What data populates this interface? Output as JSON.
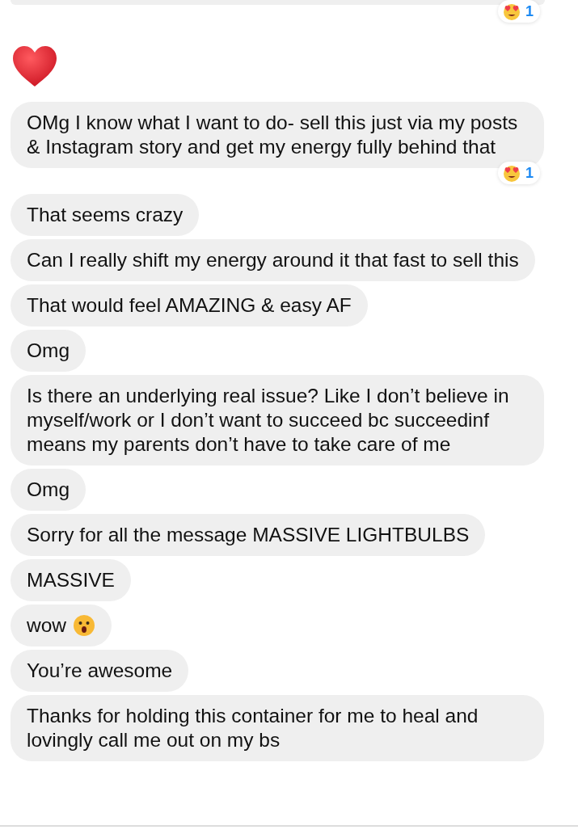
{
  "messages": [
    {
      "kind": "clipped",
      "reaction": {
        "count": "1"
      }
    },
    {
      "kind": "heart"
    },
    {
      "kind": "text",
      "text": "OMg I know what I want to do- sell this just via my posts & Instagram story and get my energy fully behind that",
      "reaction": {
        "count": "1"
      }
    },
    {
      "kind": "text",
      "text": "That seems crazy"
    },
    {
      "kind": "text",
      "text": "Can I really shift my energy around it that fast to sell this"
    },
    {
      "kind": "text",
      "text": "That would feel AMAZING & easy AF"
    },
    {
      "kind": "text",
      "text": "Omg"
    },
    {
      "kind": "text",
      "text": "Is there an underlying real issue? Like I don’t believe in myself/work or I don’t want to succeed bc succeedinf means my parents don’t have to take care of me"
    },
    {
      "kind": "text",
      "text": "Omg"
    },
    {
      "kind": "text",
      "text": "Sorry for all the message MASSIVE LIGHTBULBS"
    },
    {
      "kind": "text",
      "text": "MASSIVE"
    },
    {
      "kind": "text",
      "text": "wow",
      "emoji": true
    },
    {
      "kind": "text",
      "text": "You’re awesome"
    },
    {
      "kind": "text",
      "text": "Thanks for holding this container for me to heal and lovingly call me out on my bs"
    }
  ]
}
